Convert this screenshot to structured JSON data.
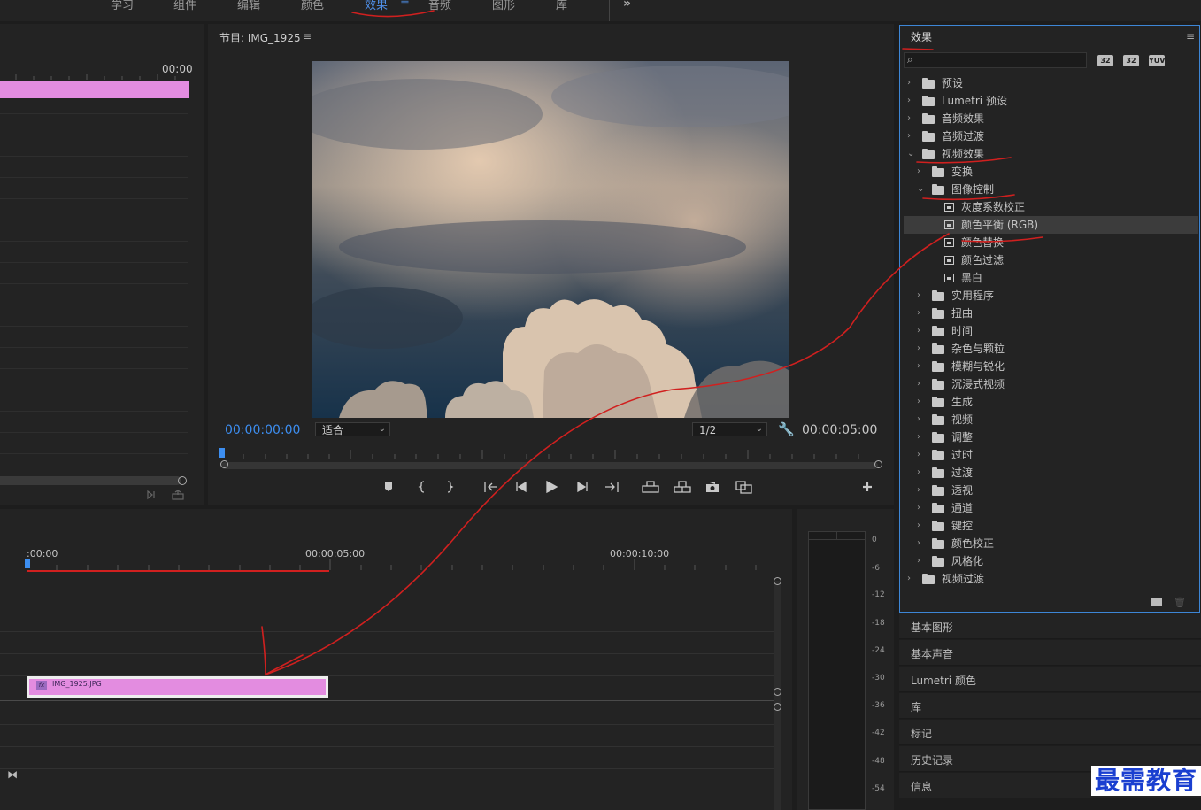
{
  "workspaces": [
    {
      "label": "学习",
      "active": false
    },
    {
      "label": "组件",
      "active": false
    },
    {
      "label": "编辑",
      "active": false
    },
    {
      "label": "颜色",
      "active": false
    },
    {
      "label": "效果",
      "active": true
    },
    {
      "label": "音频",
      "active": false
    },
    {
      "label": "图形",
      "active": false
    },
    {
      "label": "库",
      "active": false
    }
  ],
  "workspace_menu_glyph": "≡",
  "workspace_more_glyph": "»",
  "source": {
    "timecode": "00:00"
  },
  "program": {
    "title": "节目: IMG_1925",
    "menu_glyph": "≡",
    "timecode_current": "00:00:00:00",
    "timecode_duration": "00:00:05:00",
    "zoom": "适合",
    "resolution": "1/2",
    "transport_icons": [
      "marker-icon",
      "mark-in-icon",
      "mark-out-icon",
      "go-to-in-icon",
      "step-back-icon",
      "play-icon",
      "step-forward-icon",
      "go-to-out-icon",
      "lift-icon",
      "extract-icon",
      "export-frame-icon",
      "compare-icon",
      "add-button-icon"
    ]
  },
  "timeline": {
    "ticks": [
      ":00:00",
      "00:00:05:00",
      "00:00:10:00"
    ],
    "clip_name": "IMG_1925.JPG",
    "clip_fx": "fx"
  },
  "meter": {
    "labels": [
      "0",
      "-6",
      "-12",
      "-18",
      "-24",
      "-30",
      "-36",
      "-42",
      "-48",
      "-54"
    ]
  },
  "effects": {
    "title": "效果",
    "menu_glyph": "≡",
    "search_placeholder": "",
    "badges": [
      "32",
      "32",
      "YUV"
    ],
    "tree": [
      {
        "label": "预设",
        "depth": 0,
        "kind": "preset-folder",
        "expanded": false
      },
      {
        "label": "Lumetri 预设",
        "depth": 0,
        "kind": "preset-folder",
        "expanded": false
      },
      {
        "label": "音频效果",
        "depth": 0,
        "kind": "folder",
        "expanded": false
      },
      {
        "label": "音频过渡",
        "depth": 0,
        "kind": "folder",
        "expanded": false
      },
      {
        "label": "视频效果",
        "depth": 0,
        "kind": "folder",
        "expanded": true
      },
      {
        "label": "变换",
        "depth": 1,
        "kind": "folder",
        "expanded": false
      },
      {
        "label": "图像控制",
        "depth": 1,
        "kind": "folder",
        "expanded": true
      },
      {
        "label": "灰度系数校正",
        "depth": 2,
        "kind": "effect"
      },
      {
        "label": "颜色平衡 (RGB)",
        "depth": 2,
        "kind": "effect",
        "selected": true
      },
      {
        "label": "颜色替换",
        "depth": 2,
        "kind": "effect"
      },
      {
        "label": "颜色过滤",
        "depth": 2,
        "kind": "effect"
      },
      {
        "label": "黑白",
        "depth": 2,
        "kind": "effect"
      },
      {
        "label": "实用程序",
        "depth": 1,
        "kind": "folder",
        "expanded": false
      },
      {
        "label": "扭曲",
        "depth": 1,
        "kind": "folder",
        "expanded": false
      },
      {
        "label": "时间",
        "depth": 1,
        "kind": "folder",
        "expanded": false
      },
      {
        "label": "杂色与颗粒",
        "depth": 1,
        "kind": "folder",
        "expanded": false
      },
      {
        "label": "模糊与锐化",
        "depth": 1,
        "kind": "folder",
        "expanded": false
      },
      {
        "label": "沉浸式视频",
        "depth": 1,
        "kind": "folder",
        "expanded": false
      },
      {
        "label": "生成",
        "depth": 1,
        "kind": "folder",
        "expanded": false
      },
      {
        "label": "视频",
        "depth": 1,
        "kind": "folder",
        "expanded": false
      },
      {
        "label": "调整",
        "depth": 1,
        "kind": "folder",
        "expanded": false
      },
      {
        "label": "过时",
        "depth": 1,
        "kind": "folder",
        "expanded": false
      },
      {
        "label": "过渡",
        "depth": 1,
        "kind": "folder",
        "expanded": false
      },
      {
        "label": "透视",
        "depth": 1,
        "kind": "folder",
        "expanded": false
      },
      {
        "label": "通道",
        "depth": 1,
        "kind": "folder",
        "expanded": false
      },
      {
        "label": "键控",
        "depth": 1,
        "kind": "folder",
        "expanded": false
      },
      {
        "label": "颜色校正",
        "depth": 1,
        "kind": "folder",
        "expanded": false
      },
      {
        "label": "风格化",
        "depth": 1,
        "kind": "folder",
        "expanded": false
      },
      {
        "label": "视频过渡",
        "depth": 0,
        "kind": "folder",
        "expanded": false
      }
    ]
  },
  "right_panels": [
    "基本图形",
    "基本声音",
    "Lumetri 颜色",
    "库",
    "标记",
    "历史记录",
    "信息"
  ],
  "watermark": "最需教育",
  "colors": {
    "accent": "#3d8ef0",
    "clip": "#e38ce0",
    "annotation": "#d0201f",
    "panel_border": "#3d86d6"
  }
}
